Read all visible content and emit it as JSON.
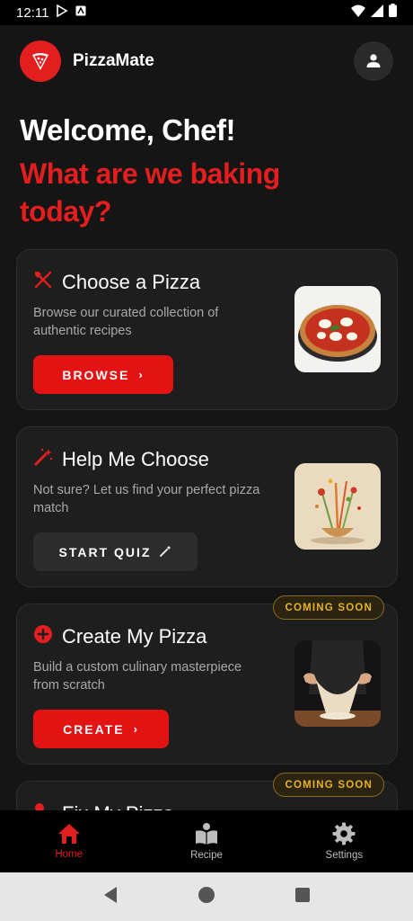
{
  "status_bar": {
    "time": "12:11"
  },
  "header": {
    "app_title": "PizzaMate"
  },
  "hero": {
    "title": "Welcome, Chef!",
    "subtitle": "What are we baking today?"
  },
  "cards": [
    {
      "title": "Choose a Pizza",
      "description": "Browse our curated collection of authentic recipes",
      "button_label": "BROWSE"
    },
    {
      "title": "Help Me Choose",
      "description": "Not sure? Let us find your perfect pizza match",
      "button_label": "START QUIZ"
    },
    {
      "title": "Create My Pizza",
      "description": "Build a custom culinary masterpiece from scratch",
      "button_label": "CREATE",
      "badge": "COMING SOON"
    },
    {
      "title": "Fix My Pizza",
      "badge": "COMING SOON"
    }
  ],
  "bottom_nav": [
    {
      "label": "Home",
      "icon": "home-icon",
      "active": true
    },
    {
      "label": "Recipe",
      "icon": "recipe-book-icon",
      "active": false
    },
    {
      "label": "Settings",
      "icon": "gear-icon",
      "active": false
    }
  ],
  "colors": {
    "accent": "#e31e1e",
    "background": "#151515",
    "card": "#1e1e1e",
    "badge_text": "#e6b325"
  }
}
